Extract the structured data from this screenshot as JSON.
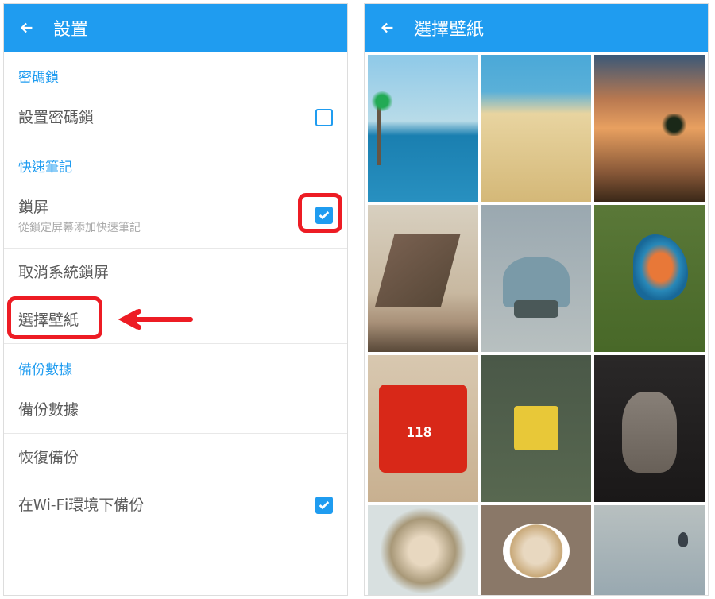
{
  "accent_color": "#1f9cf0",
  "highlight_color": "#ed1c24",
  "left": {
    "header_title": "設置",
    "sections": {
      "password": {
        "header": "密碼鎖",
        "set_password": "設置密碼鎖"
      },
      "quicknote": {
        "header": "快速筆記",
        "lockscreen_title": "鎖屏",
        "lockscreen_sub": "從鎖定屏幕添加快速筆記",
        "cancel_syslock": "取消系統鎖屏",
        "choose_wallpaper": "選擇壁紙"
      },
      "backup": {
        "header": "備份數據",
        "backup_data": "備份數據",
        "restore_backup": "恢復備份",
        "wifi_backup": "在Wi-Fi環境下備份"
      }
    }
  },
  "right": {
    "header_title": "選擇壁紙",
    "thumbs": {
      "bus_number": "118"
    }
  }
}
